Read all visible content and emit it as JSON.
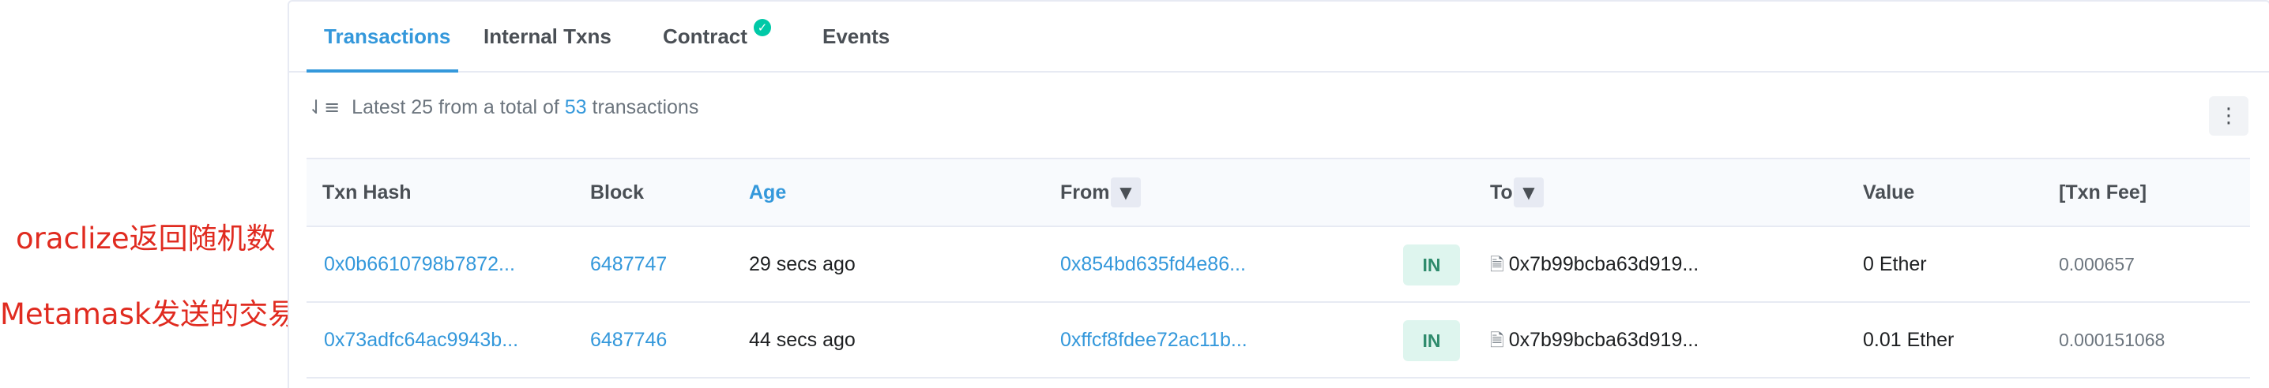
{
  "annotations": [
    "oraclize返回随机数",
    "Metamask发送的交易"
  ],
  "tabs": {
    "transactions": "Transactions",
    "internal": "Internal Txns",
    "contract": "Contract",
    "events": "Events"
  },
  "summary": {
    "prefix": "Latest 25 from a total of",
    "count": "53",
    "suffix": "transactions"
  },
  "columns": {
    "txn_hash": "Txn Hash",
    "block": "Block",
    "age": "Age",
    "from": "From",
    "to": "To",
    "value": "Value",
    "fee": "[Txn Fee]"
  },
  "rows": [
    {
      "hash": "0x0b6610798b7872...",
      "block": "6487747",
      "age": "29 secs ago",
      "from": "0x854bd635fd4e86...",
      "direction": "IN",
      "to": "0x7b99bcba63d919...",
      "value": "0 Ether",
      "fee": "0.000657"
    },
    {
      "hash": "0x73adfc64ac9943b...",
      "block": "6487746",
      "age": "44 secs ago",
      "from": "0xffcf8fdee72ac11b...",
      "direction": "IN",
      "to": "0x7b99bcba63d919...",
      "value": "0.01 Ether",
      "fee": "0.000151068"
    }
  ],
  "icons": {
    "sort": "sort-descending-icon",
    "check": "verified-check-icon",
    "filter": "filter-icon",
    "more": "more-vertical-icon",
    "contract_doc": "document-icon"
  },
  "colors": {
    "link": "#3498db",
    "badge_bg": "#def5ee",
    "badge_text": "#2e8b6c",
    "annotation": "#e02b20"
  }
}
